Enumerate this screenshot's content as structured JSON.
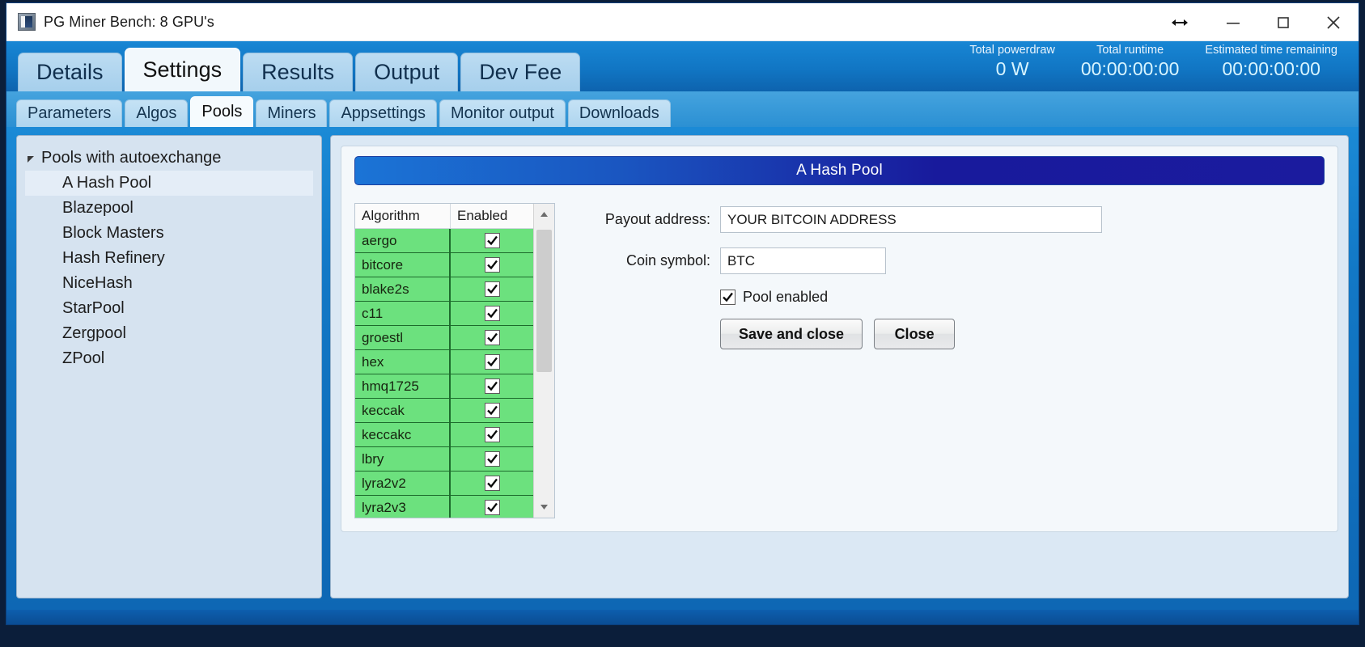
{
  "window": {
    "title": "PG Miner Bench: 8 GPU's",
    "icon": "app-icon",
    "controls": {
      "restore_label": "↔",
      "minimize_label": "–",
      "maximize_label": "□",
      "close_label": "✕"
    }
  },
  "status": {
    "items": [
      {
        "label": "Total powerdraw",
        "value": "0 W"
      },
      {
        "label": "Total runtime",
        "value": "00:00:00:00"
      },
      {
        "label": "Estimated time remaining",
        "value": "00:00:00:00"
      }
    ]
  },
  "main_tabs": [
    {
      "label": "Details",
      "active": false
    },
    {
      "label": "Settings",
      "active": true
    },
    {
      "label": "Results",
      "active": false
    },
    {
      "label": "Output",
      "active": false
    },
    {
      "label": "Dev Fee",
      "active": false
    }
  ],
  "sub_tabs": [
    {
      "label": "Parameters",
      "active": false
    },
    {
      "label": "Algos",
      "active": false
    },
    {
      "label": "Pools",
      "active": true
    },
    {
      "label": "Miners",
      "active": false
    },
    {
      "label": "Appsettings",
      "active": false
    },
    {
      "label": "Monitor output",
      "active": false
    },
    {
      "label": "Downloads",
      "active": false
    }
  ],
  "tree": {
    "root_label": "Pools with autoexchange",
    "expanded": true,
    "children": [
      {
        "label": "A Hash Pool",
        "selected": true
      },
      {
        "label": "Blazepool",
        "selected": false
      },
      {
        "label": "Block Masters",
        "selected": false
      },
      {
        "label": "Hash Refinery",
        "selected": false
      },
      {
        "label": "NiceHash",
        "selected": false
      },
      {
        "label": "StarPool",
        "selected": false
      },
      {
        "label": "Zergpool",
        "selected": false
      },
      {
        "label": "ZPool",
        "selected": false
      }
    ]
  },
  "pool_panel": {
    "title": "A Hash Pool",
    "grid": {
      "columns": [
        "Algorithm",
        "Enabled"
      ],
      "rows": [
        {
          "algorithm": "aergo",
          "enabled": true
        },
        {
          "algorithm": "bitcore",
          "enabled": true
        },
        {
          "algorithm": "blake2s",
          "enabled": true
        },
        {
          "algorithm": "c11",
          "enabled": true
        },
        {
          "algorithm": "groestl",
          "enabled": true
        },
        {
          "algorithm": "hex",
          "enabled": true
        },
        {
          "algorithm": "hmq1725",
          "enabled": true
        },
        {
          "algorithm": "keccak",
          "enabled": true
        },
        {
          "algorithm": "keccakc",
          "enabled": true
        },
        {
          "algorithm": "lbry",
          "enabled": true
        },
        {
          "algorithm": "lyra2v2",
          "enabled": true
        },
        {
          "algorithm": "lyra2v3",
          "enabled": true
        }
      ]
    },
    "form": {
      "payout_label": "Payout address:",
      "payout_value": "YOUR BITCOIN ADDRESS",
      "coin_label": "Coin symbol:",
      "coin_value": "BTC",
      "pool_enabled_label": "Pool enabled",
      "pool_enabled": true,
      "save_label": "Save and close",
      "close_label": "Close"
    }
  },
  "colors": {
    "accent": "#1176c4",
    "grid_row": "#6ce17e",
    "grid_row_border": "#1d6b2c",
    "title_bar_gradient_start": "#1b74d6",
    "title_bar_gradient_end": "#1b1b9e",
    "status_value": "#d8f5ff"
  }
}
